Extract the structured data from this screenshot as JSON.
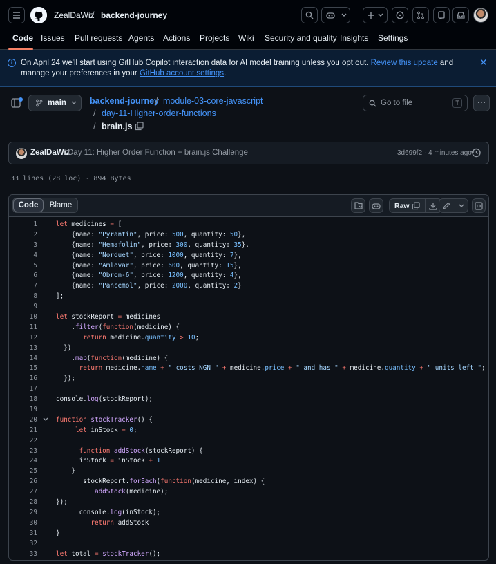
{
  "header": {
    "owner": "ZealDaWiz",
    "separator": "/",
    "repo": "backend-journey",
    "nav": [
      "Code",
      "Issues",
      "Pull requests",
      "Agents",
      "Actions",
      "Projects",
      "Wiki",
      "Security and quality",
      "Insights",
      "Settings"
    ],
    "active_tab": "Code",
    "icons": [
      "menu-icon",
      "github-logo-icon",
      "search-icon",
      "copilot-icon",
      "chevron-down-icon",
      "plus-icon",
      "issue-icon",
      "pull-request-icon",
      "repo-icon",
      "inbox-icon"
    ]
  },
  "banner": {
    "text_before": "On April 24 we'll start using GitHub Copilot interaction data for AI model training unless you opt out. ",
    "link1": "Review this update",
    "text_middle": " and manage your preferences in your ",
    "link2": "GitHub account settings",
    "text_after": ".",
    "close": "✕"
  },
  "file_nav": {
    "branch": "main",
    "path": [
      "backend-journey",
      "module-03-core-javascript",
      "day-11-Higher-order-functions"
    ],
    "separator": "/",
    "file": "brain.js",
    "goto_placeholder": "Go to file",
    "goto_key": "T",
    "more": "···"
  },
  "commit": {
    "author": "ZealDaWiz",
    "message": "Day 11: Higher Order Function + brain.js Challenge",
    "meta": "3d699f2 · 4 minutes ago"
  },
  "file_info": "33 lines (28 loc) · 894 Bytes",
  "code_view": {
    "tabs": [
      "Code",
      "Blame"
    ],
    "raw_label": "Raw",
    "lines": [
      {
        "n": "1",
        "t": "let medicines = ["
      },
      {
        "n": "2",
        "t": "    {name: \"Pyrantin\", price: 500, quantity: 50},"
      },
      {
        "n": "3",
        "t": "    {name: \"Hemafolin\", price: 300, quantity: 35},"
      },
      {
        "n": "4",
        "t": "    {name: \"Norduet\", price: 1000, quantity: 7},"
      },
      {
        "n": "5",
        "t": "    {name: \"Amlovar\", price: 600, quantity: 15},"
      },
      {
        "n": "6",
        "t": "    {name: \"Obron-6\", price: 1200, quantity: 4},"
      },
      {
        "n": "7",
        "t": "    {name: \"Pancemol\", price: 2000, quantity: 2}"
      },
      {
        "n": "8",
        "t": "];"
      },
      {
        "n": "9",
        "t": ""
      },
      {
        "n": "10",
        "t": "let stockReport = medicines"
      },
      {
        "n": "11",
        "t": "    .filter(function(medicine) {"
      },
      {
        "n": "12",
        "t": "       return medicine.quantity > 10;"
      },
      {
        "n": "13",
        "t": "  })"
      },
      {
        "n": "14",
        "t": "    .map(function(medicine) {"
      },
      {
        "n": "15",
        "t": "      return medicine.name + \" costs NGN \" + medicine.price + \" and has \" + medicine.quantity + \" units left \";"
      },
      {
        "n": "16",
        "t": "  });"
      },
      {
        "n": "17",
        "t": ""
      },
      {
        "n": "18",
        "t": "console.log(stockReport);"
      },
      {
        "n": "19",
        "t": ""
      },
      {
        "n": "20",
        "t": "function stockTracker() {"
      },
      {
        "n": "21",
        "t": "     let inStock = 0;"
      },
      {
        "n": "22",
        "t": ""
      },
      {
        "n": "23",
        "t": "      function addStock(stockReport) {"
      },
      {
        "n": "24",
        "t": "      inStock = inStock + 1"
      },
      {
        "n": "25",
        "t": "    }"
      },
      {
        "n": "26",
        "t": "       stockReport.forEach(function(medicine, index) {"
      },
      {
        "n": "27",
        "t": "          addStock(medicine);"
      },
      {
        "n": "28",
        "t": "});"
      },
      {
        "n": "29",
        "t": "      console.log(inStock);"
      },
      {
        "n": "30",
        "t": "         return addStock"
      },
      {
        "n": "31",
        "t": "}"
      },
      {
        "n": "32",
        "t": ""
      },
      {
        "n": "33",
        "t": "let total = stockTracker();"
      }
    ]
  }
}
